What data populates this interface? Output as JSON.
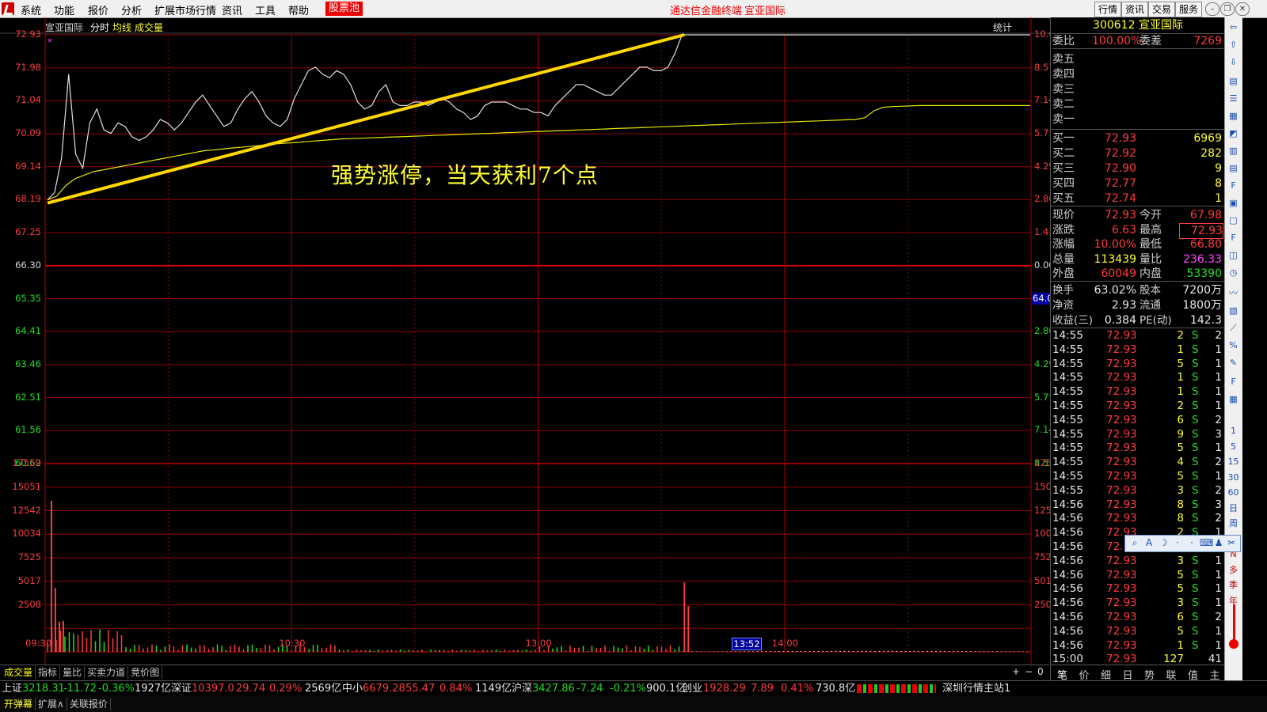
{
  "menu": {
    "items": [
      "系统",
      "功能",
      "报价",
      "分析",
      "扩展市场行情",
      "资讯",
      "工具",
      "帮助"
    ],
    "highlight": "股票池",
    "center_text": "通达信金融终端",
    "stock_name_title": "宣亚国际",
    "right_buttons": [
      "行情",
      "资讯",
      "交易",
      "服务"
    ]
  },
  "chart": {
    "stock_name": "宣亚国际",
    "mode": "分时",
    "avg_label": "均线",
    "vol_label": "成交量",
    "stat_label": "统计",
    "annotation": "强势涨停，当天获利7个点",
    "price_marker": "64.00",
    "time_marker": "13:52",
    "price_left": [
      "72.93",
      "71.98",
      "71.04",
      "70.09",
      "69.14",
      "68.19",
      "67.25",
      "66.30",
      "65.35",
      "64.41",
      "63.46",
      "62.51",
      "61.56",
      "60.62"
    ],
    "pct_right": [
      "10.00%",
      "8.57%",
      "7.14%",
      "5.71%",
      "4.29%",
      "2.86%",
      "1.43%",
      "0.00%",
      "1.43%",
      "2.86%",
      "4.29%",
      "5.71%",
      "7.14%",
      "8.57%"
    ],
    "vol_left": [
      "17559",
      "15051",
      "12542",
      "10034",
      "7525",
      "5017",
      "2508"
    ],
    "vol_right": [
      "17559",
      "15051",
      "12542",
      "10034",
      "7525",
      "5017",
      "2508"
    ],
    "time_labels": [
      "09:30",
      "10:30",
      "13:00",
      "14:00"
    ],
    "colors": {
      "up": "#ff3b3b",
      "down": "#22dd22",
      "price_line": "#e0e0e0",
      "avg_line": "#e6e600",
      "trend": "#ffd700",
      "grid": "#b00000"
    }
  },
  "chart_data": {
    "type": "line",
    "price_axis": {
      "min": 60.62,
      "max": 72.93,
      "prev_close": 66.3
    },
    "price": [
      68.19,
      68.4,
      69.4,
      71.8,
      69.5,
      69.1,
      70.4,
      70.8,
      70.2,
      70.1,
      70.4,
      70.3,
      70.0,
      69.9,
      70.0,
      70.2,
      70.5,
      70.4,
      70.2,
      70.4,
      70.7,
      71.0,
      71.2,
      70.9,
      70.6,
      70.3,
      70.4,
      70.8,
      71.1,
      71.3,
      71.0,
      70.6,
      70.4,
      70.3,
      70.5,
      71.1,
      71.5,
      71.9,
      72.0,
      71.8,
      71.7,
      71.9,
      71.8,
      71.5,
      71.0,
      70.8,
      70.9,
      71.3,
      71.5,
      71.0,
      70.9,
      70.9,
      71.0,
      71.0,
      70.9,
      71.0,
      71.1,
      71.0,
      70.8,
      70.7,
      70.5,
      70.6,
      70.9,
      71.0,
      71.0,
      71.0,
      70.9,
      70.8,
      70.8,
      70.7,
      70.7,
      70.6,
      70.9,
      71.1,
      71.3,
      71.5,
      71.5,
      71.4,
      71.3,
      71.2,
      71.2,
      71.4,
      71.6,
      71.8,
      72.0,
      72.0,
      71.9,
      71.9,
      72.0,
      72.4,
      72.93
    ],
    "avg": [
      68.19,
      68.3,
      68.6,
      68.8,
      68.9,
      69.0,
      69.05,
      69.1,
      69.15,
      69.2,
      69.25,
      69.3,
      69.35,
      69.4,
      69.45,
      69.5,
      69.55,
      69.6,
      69.62,
      69.65,
      69.68,
      69.7,
      69.72,
      69.75,
      69.78,
      69.8,
      69.82,
      69.84,
      69.86,
      69.88,
      69.9,
      69.92,
      69.94,
      69.95,
      69.96,
      69.97,
      69.98,
      69.99,
      70.0,
      70.01,
      70.02,
      70.03,
      70.04,
      70.05,
      70.06,
      70.07,
      70.08,
      70.09,
      70.1,
      70.11,
      70.12,
      70.13,
      70.14,
      70.15,
      70.16,
      70.17,
      70.18,
      70.19,
      70.2,
      70.21,
      70.22,
      70.23,
      70.24,
      70.25,
      70.26,
      70.27,
      70.28,
      70.29,
      70.3,
      70.31,
      70.32,
      70.33,
      70.34,
      70.35,
      70.36,
      70.37,
      70.38,
      70.39,
      70.4,
      70.41,
      70.42,
      70.43,
      70.44,
      70.45,
      70.46,
      70.47,
      70.48,
      70.49,
      70.5,
      70.55,
      70.75,
      70.85,
      70.87,
      70.88,
      70.89,
      70.9,
      70.9,
      70.9,
      70.9,
      70.9,
      70.9,
      70.9,
      70.9,
      70.9,
      70.9,
      70.9,
      70.9,
      70.9
    ],
    "volume_axis": {
      "min": 0,
      "max": 20067
    },
    "volume_spikes": [
      {
        "t": 0.004,
        "v": 16100
      },
      {
        "t": 0.008,
        "v": 6800
      },
      {
        "t": 0.012,
        "v": 3200
      },
      {
        "t": 0.016,
        "v": 3300
      },
      {
        "t": 0.646,
        "v": 7400
      },
      {
        "t": 0.65,
        "v": 4900
      }
    ]
  },
  "quote": {
    "code": "300612",
    "name": "宣亚国际",
    "weibi_label": "委比",
    "weibi": "100.00%",
    "weicha_label": "委差",
    "weicha": "7269",
    "sell": [
      {
        "label": "卖五"
      },
      {
        "label": "卖四"
      },
      {
        "label": "卖三"
      },
      {
        "label": "卖二"
      },
      {
        "label": "卖一"
      }
    ],
    "buy": [
      {
        "label": "买一",
        "price": "72.93",
        "vol": "6969"
      },
      {
        "label": "买二",
        "price": "72.92",
        "vol": "282"
      },
      {
        "label": "买三",
        "price": "72.90",
        "vol": "9"
      },
      {
        "label": "买四",
        "price": "72.77",
        "vol": "8"
      },
      {
        "label": "买五",
        "price": "72.74",
        "vol": "1"
      }
    ],
    "stats": [
      {
        "k1": "现价",
        "v1": "72.93",
        "k2": "今开",
        "v2": "67.98"
      },
      {
        "k1": "涨跌",
        "v1": "6.63",
        "k2": "最高",
        "v2": "72.93"
      },
      {
        "k1": "涨幅",
        "v1": "10.00%",
        "k2": "最低",
        "v2": "66.80"
      },
      {
        "k1": "总量",
        "v1": "113439",
        "k2": "量比",
        "v2": "236.33"
      },
      {
        "k1": "外盘",
        "v1": "60049",
        "k2": "内盘",
        "v2": "53390"
      }
    ],
    "fund": [
      {
        "k1": "换手",
        "v1": "63.02%",
        "k2": "股本",
        "v2": "7200万"
      },
      {
        "k1": "净资",
        "v1": "2.93",
        "k2": "流通",
        "v2": "1800万"
      },
      {
        "k1": "收益(三)",
        "v1": "0.384",
        "k2": "PE(动)",
        "v2": "142.3"
      }
    ]
  },
  "ticks": [
    {
      "t": "14:55",
      "p": "72.93",
      "v": "2",
      "s": "S",
      "n": "2"
    },
    {
      "t": "14:55",
      "p": "72.93",
      "v": "1",
      "s": "S",
      "n": "1"
    },
    {
      "t": "14:55",
      "p": "72.93",
      "v": "5",
      "s": "S",
      "n": "1"
    },
    {
      "t": "14:55",
      "p": "72.93",
      "v": "1",
      "s": "S",
      "n": "1"
    },
    {
      "t": "14:55",
      "p": "72.93",
      "v": "1",
      "s": "S",
      "n": "1"
    },
    {
      "t": "14:55",
      "p": "72.93",
      "v": "2",
      "s": "S",
      "n": "1"
    },
    {
      "t": "14:55",
      "p": "72.93",
      "v": "6",
      "s": "S",
      "n": "2"
    },
    {
      "t": "14:55",
      "p": "72.93",
      "v": "9",
      "s": "S",
      "n": "3"
    },
    {
      "t": "14:55",
      "p": "72.93",
      "v": "5",
      "s": "S",
      "n": "1"
    },
    {
      "t": "14:55",
      "p": "72.93",
      "v": "4",
      "s": "S",
      "n": "2"
    },
    {
      "t": "14:55",
      "p": "72.93",
      "v": "5",
      "s": "S",
      "n": "1"
    },
    {
      "t": "14:55",
      "p": "72.93",
      "v": "3",
      "s": "S",
      "n": "2"
    },
    {
      "t": "14:56",
      "p": "72.93",
      "v": "8",
      "s": "S",
      "n": "3"
    },
    {
      "t": "14:56",
      "p": "72.93",
      "v": "8",
      "s": "S",
      "n": "2"
    },
    {
      "t": "14:56",
      "p": "72.93",
      "v": "2",
      "s": "S",
      "n": "1"
    },
    {
      "t": "14:56",
      "p": "72.",
      "v": "",
      "s": "",
      "n": ""
    },
    {
      "t": "14:56",
      "p": "72.93",
      "v": "3",
      "s": "S",
      "n": "1"
    },
    {
      "t": "14:56",
      "p": "72.93",
      "v": "5",
      "s": "S",
      "n": "1"
    },
    {
      "t": "14:56",
      "p": "72.93",
      "v": "5",
      "s": "S",
      "n": "1"
    },
    {
      "t": "14:56",
      "p": "72.93",
      "v": "3",
      "s": "S",
      "n": "1"
    },
    {
      "t": "14:56",
      "p": "72.93",
      "v": "6",
      "s": "S",
      "n": "2"
    },
    {
      "t": "14:56",
      "p": "72.93",
      "v": "5",
      "s": "S",
      "n": "1"
    },
    {
      "t": "14:56",
      "p": "72.93",
      "v": "1",
      "s": "S",
      "n": "1"
    },
    {
      "t": "15:00",
      "p": "72.93",
      "v": "127",
      "s": "",
      "n": "41"
    }
  ],
  "bottom_tabs_row1": [
    "成交量",
    "指标",
    "量比",
    "买卖力道",
    "竞价图"
  ],
  "bottom_tabs_row2": [
    "开弹幕",
    "扩展∧",
    "关联报价"
  ],
  "bottom_right_ctrl": [
    "+",
    "−",
    "0"
  ],
  "rpanel_tabs": [
    "笔",
    "价",
    "细",
    "日",
    "势",
    "联",
    "值",
    "主"
  ],
  "iconbar_labels": [
    "1",
    "5",
    "15",
    "30",
    "60",
    "日",
    "周",
    "月",
    "N",
    "多",
    "季",
    "年"
  ],
  "status": {
    "sh_label": "上证",
    "sh": "3218.31",
    "sh_chg": "-11.72",
    "sh_pct": "-0.36%",
    "sh_amt": "1927亿",
    "sz_label": "深证",
    "sz": "10397.0",
    "sz_chg": "29.74",
    "sz_pct": "0.29%",
    "sz_amt": "2569亿",
    "zx_label": "中小",
    "zx": "6679.28",
    "zx_chg": "55.47",
    "zx_pct": "0.84%",
    "zx_amt": "1149亿",
    "hs_label": "沪深",
    "hs": "3427.86",
    "hs_chg": "-7.24",
    "hs_pct": "-0.21%",
    "hs_amt": "900.1亿",
    "cy_label": "创业",
    "cy": "1928.29",
    "cy_chg": "7.89",
    "cy_pct": "0.41%",
    "cy_amt": "730.8亿",
    "server": "深圳行情主站1"
  }
}
